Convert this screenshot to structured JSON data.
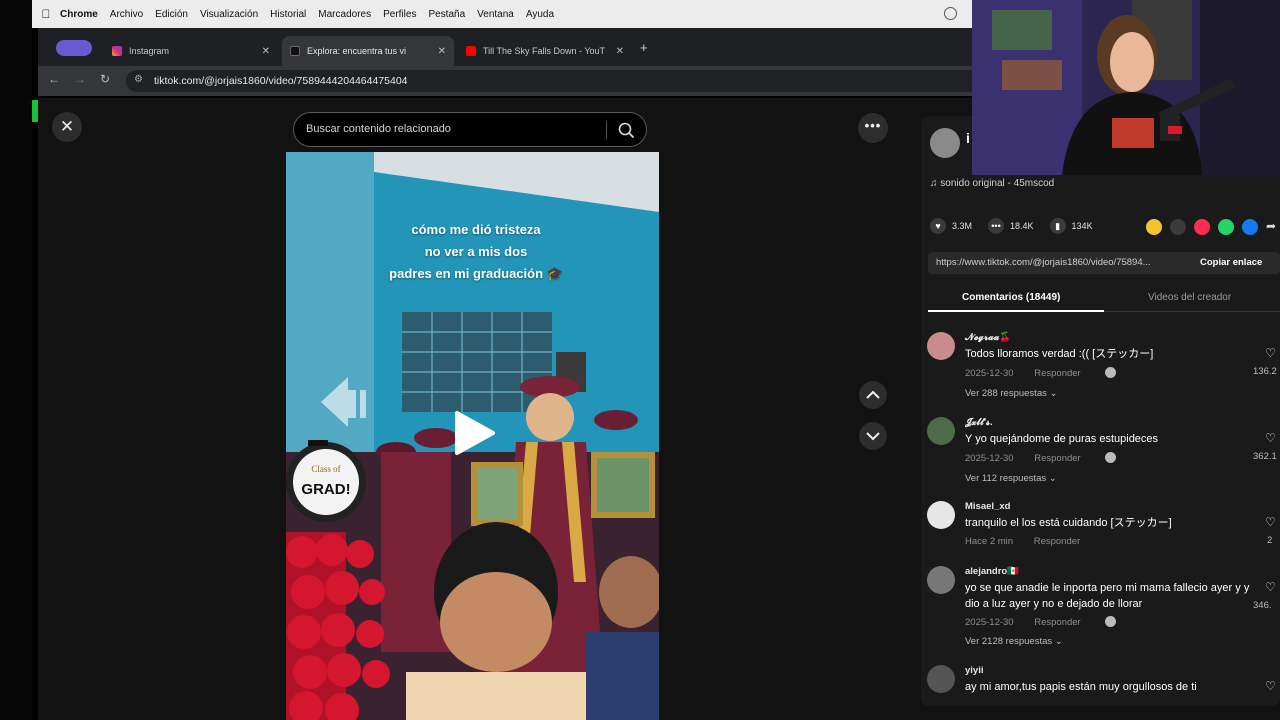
{
  "menubar": {
    "items": [
      "Chrome",
      "Archivo",
      "Edición",
      "Visualización",
      "Historial",
      "Marcadores",
      "Perfiles",
      "Pestaña",
      "Ventana",
      "Ayuda"
    ]
  },
  "tabs": [
    {
      "title": "Instagram",
      "active": false
    },
    {
      "title": "Explora: encuentra tus vi",
      "active": true
    },
    {
      "title": "Till The Sky Falls Down - YouT",
      "active": false
    }
  ],
  "address": {
    "url": "tiktok.com/@jorjais1860/video/7589444204464475404"
  },
  "search": {
    "placeholder": "Buscar contenido relacionado"
  },
  "video": {
    "caption_lines": [
      "cómo me dió tristeza",
      "no ver a mis dos",
      "padres en mi graduación 🎓"
    ],
    "balloon_text_1": "Class of",
    "balloon_text_2": "GRAD!"
  },
  "panel": {
    "author_initial": "i",
    "sound": "sonido original - 45mscod",
    "likes": "3.3M",
    "comments": "18.4K",
    "saves": "134K",
    "link": "https://www.tiktok.com/@jorjais1860/video/75894...",
    "copy_label": "Copiar enlace",
    "tab_comments": "Comentarios (18449)",
    "tab_creator": "Videos del creador"
  },
  "comments": [
    {
      "name": "𝓝𝓮𝓰𝓻𝓪𝓪🍒",
      "text": "Todos lloramos verdad :(( [ステッカー]",
      "date": "2025-12-30",
      "reply": "Responder",
      "replies": "Ver 288 respuestas",
      "likes": "136.2"
    },
    {
      "name": "𝓙𝔁𝓵𝓵'𝓼.",
      "text": "Y yo quejándome de puras estupideces",
      "date": "2025-12-30",
      "reply": "Responder",
      "replies": "Ver 112 respuestas",
      "likes": "362.1"
    },
    {
      "name": "Misael_xd",
      "text": "tranquilo el los está cuidando [ステッカー]",
      "date": "Hace 2 min",
      "reply": "Responder",
      "replies": "",
      "likes": "2"
    },
    {
      "name": "alejandro🇲🇽",
      "text": "yo se que anadie le inporta pero mi mama fallecio ayer y y dio a luz ayer y no e dejado de llorar",
      "date": "2025-12-30",
      "reply": "Responder",
      "replies": "Ver 2128 respuestas",
      "likes": "346."
    },
    {
      "name": "yiyii",
      "text": "ay mi amor,tus papis están muy orgullosos de ti",
      "date": "",
      "reply": "",
      "replies": "",
      "likes": ""
    }
  ],
  "colors": {
    "accent_red": "#fe2c55",
    "video_wall": "#1f8fb3",
    "gown": "#7a2238"
  }
}
